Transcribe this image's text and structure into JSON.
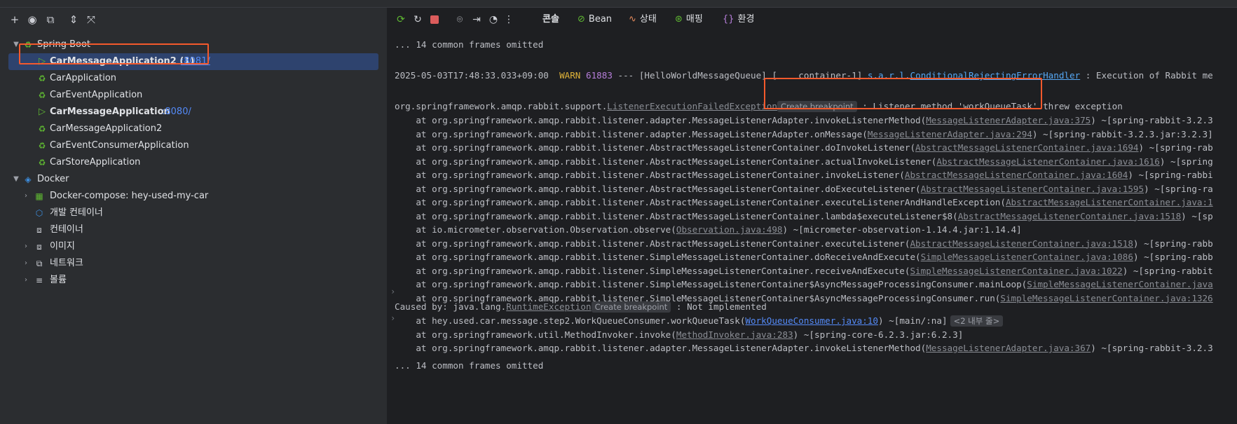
{
  "services": {
    "toolbar": [
      "add-icon",
      "eye-icon",
      "new-window-icon",
      "expand-all-icon",
      "collapse-all-icon"
    ],
    "spring_boot": {
      "label": "Spring Boot",
      "apps": [
        {
          "name": "CarMessageApplication2 (1)",
          "port": ":8081/",
          "running": true
        },
        {
          "name": "CarApplication",
          "port": "",
          "running": false
        },
        {
          "name": "CarEventApplication",
          "port": "",
          "running": false
        },
        {
          "name": "CarMessageApplication",
          "port": ":8080/",
          "running": true
        },
        {
          "name": "CarMessageApplication2",
          "port": "",
          "running": false
        },
        {
          "name": "CarEventConsumerApplication",
          "port": "",
          "running": false
        },
        {
          "name": "CarStoreApplication",
          "port": "",
          "running": false
        }
      ]
    },
    "docker": {
      "label": "Docker",
      "items": [
        {
          "label": "Docker-compose: hey-used-my-car"
        },
        {
          "label": "개발 컨테이너"
        },
        {
          "label": "컨테이너"
        },
        {
          "label": "이미지"
        },
        {
          "label": "네트워크"
        },
        {
          "label": "볼륨"
        }
      ]
    }
  },
  "console_toolbar": {
    "tabs": [
      {
        "label": "콘솔",
        "icon": ""
      },
      {
        "label": "Bean",
        "icon": "bean-icon"
      },
      {
        "label": "상태",
        "icon": "health-icon"
      },
      {
        "label": "매핑",
        "icon": "mapping-icon"
      },
      {
        "label": "환경",
        "icon": "environment-icon"
      }
    ]
  },
  "colors": {
    "accent": "#548af7",
    "highlight": "#f4592c",
    "selection": "#2e436e",
    "warn": "#e0b339"
  },
  "log": {
    "omitted": "... 14 common frames omitted",
    "warn_line": {
      "timestamp": "2025-05-03T17:48:33.033+09:00",
      "level": "WARN",
      "pid": "61883",
      "thread": " --- [HelloWorldMessageQueue] [    container-1] ",
      "logger_prefix": "s.a.r.l.",
      "logger_link": "ConditionalRejectingErrorHandler",
      "message": " : Execution of Rabbit me"
    },
    "exception_line": {
      "prefix": "org.springframework.amqp.rabbit.support.",
      "link": "ListenerExecutionFailedException",
      "breakpoint": "Create breakpoint",
      "message": " : Listener method 'workQueueTask' threw exception"
    },
    "frames": [
      {
        "prefix": "    at org.springframework.amqp.rabbit.listener.adapter.MessageListenerAdapter.invokeListenerMethod(",
        "link": "MessageListenerAdapter.java:375",
        "suffix": ") ~[spring-rabbit-3.2.3"
      },
      {
        "prefix": "    at org.springframework.amqp.rabbit.listener.adapter.MessageListenerAdapter.onMessage(",
        "link": "MessageListenerAdapter.java:294",
        "suffix": ") ~[spring-rabbit-3.2.3.jar:3.2.3]"
      },
      {
        "prefix": "    at org.springframework.amqp.rabbit.listener.AbstractMessageListenerContainer.doInvokeListener(",
        "link": "AbstractMessageListenerContainer.java:1694",
        "suffix": ") ~[spring-rab"
      },
      {
        "prefix": "    at org.springframework.amqp.rabbit.listener.AbstractMessageListenerContainer.actualInvokeListener(",
        "link": "AbstractMessageListenerContainer.java:1616",
        "suffix": ") ~[spring"
      },
      {
        "prefix": "    at org.springframework.amqp.rabbit.listener.AbstractMessageListenerContainer.invokeListener(",
        "link": "AbstractMessageListenerContainer.java:1604",
        "suffix": ") ~[spring-rabbi"
      },
      {
        "prefix": "    at org.springframework.amqp.rabbit.listener.AbstractMessageListenerContainer.doExecuteListener(",
        "link": "AbstractMessageListenerContainer.java:1595",
        "suffix": ") ~[spring-ra"
      },
      {
        "prefix": "    at org.springframework.amqp.rabbit.listener.AbstractMessageListenerContainer.executeListenerAndHandleException(",
        "link": "AbstractMessageListenerContainer.java:1",
        "suffix": ""
      },
      {
        "prefix": "    at org.springframework.amqp.rabbit.listener.AbstractMessageListenerContainer.lambda$executeListener$8(",
        "link": "AbstractMessageListenerContainer.java:1518",
        "suffix": ") ~[sp"
      },
      {
        "prefix": "    at io.micrometer.observation.Observation.observe(",
        "link": "Observation.java:498",
        "suffix": ") ~[micrometer-observation-1.14.4.jar:1.14.4]"
      },
      {
        "prefix": "    at org.springframework.amqp.rabbit.listener.AbstractMessageListenerContainer.executeListener(",
        "link": "AbstractMessageListenerContainer.java:1518",
        "suffix": ") ~[spring-rabb"
      },
      {
        "prefix": "    at org.springframework.amqp.rabbit.listener.SimpleMessageListenerContainer.doReceiveAndExecute(",
        "link": "SimpleMessageListenerContainer.java:1086",
        "suffix": ") ~[spring-rabb"
      },
      {
        "prefix": "    at org.springframework.amqp.rabbit.listener.SimpleMessageListenerContainer.receiveAndExecute(",
        "link": "SimpleMessageListenerContainer.java:1022",
        "suffix": ") ~[spring-rabbit"
      },
      {
        "prefix": "    at org.springframework.amqp.rabbit.listener.SimpleMessageListenerContainer$AsyncMessageProcessingConsumer.mainLoop(",
        "link": "SimpleMessageListenerContainer.java",
        "suffix": ""
      },
      {
        "prefix": "    at org.springframework.amqp.rabbit.listener.SimpleMessageListenerContainer$AsyncMessageProcessingConsumer.run(",
        "link": "SimpleMessageListenerContainer.java:1326",
        "suffix": ""
      }
    ],
    "caused_by": {
      "prefix": "Caused by: java.lang.",
      "link": "RuntimeException",
      "breakpoint": "Create breakpoint",
      "message": " : Not implemented"
    },
    "caused_frames": [
      {
        "prefix": "    at hey.used.car.message.step2.WorkQueueConsumer.workQueueTask(",
        "link": "WorkQueueConsumer.java:10",
        "suffix": ") ~[main/:na]",
        "badge": "<2 내부 줄>"
      },
      {
        "prefix": "    at org.springframework.util.MethodInvoker.invoke(",
        "link": "MethodInvoker.java:283",
        "suffix": ") ~[spring-core-6.2.3.jar:6.2.3]",
        "badge": ""
      },
      {
        "prefix": "    at org.springframework.amqp.rabbit.listener.adapter.MessageListenerAdapter.invokeListenerMethod(",
        "link": "MessageListenerAdapter.java:367",
        "suffix": ") ~[spring-rabbit-3.2.3",
        "badge": ""
      }
    ]
  }
}
